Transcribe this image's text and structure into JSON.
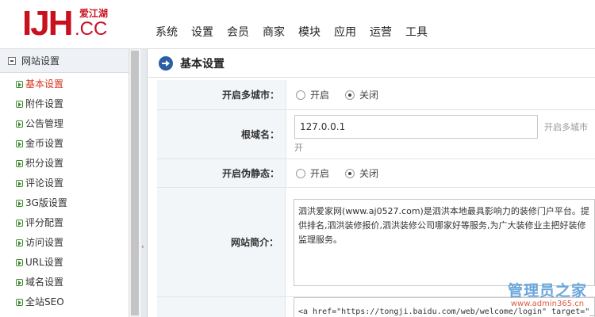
{
  "logo": {
    "main": "IJH",
    "cn": "爱江湖",
    "suffix": ".CC"
  },
  "topnav": [
    "系统",
    "设置",
    "会员",
    "商家",
    "模块",
    "应用",
    "运营",
    "工具"
  ],
  "sidebar": {
    "title": "网站设置",
    "items": [
      "基本设置",
      "附件设置",
      "公告管理",
      "金币设置",
      "积分设置",
      "评论设置",
      "3G版设置",
      "评分配置",
      "访问设置",
      "URL设置",
      "域名设置",
      "全站SEO"
    ],
    "active_index": 0
  },
  "main": {
    "title": "基本设置",
    "multi_city": {
      "label": "开启多城市：",
      "on": "开启",
      "off": "关闭",
      "selected": "关闭"
    },
    "root_domain": {
      "label": "根域名：",
      "value": "127.0.0.1",
      "hint_right": "开启多城市",
      "hint_below": "开"
    },
    "pseudo_static": {
      "label": "开启伪静态：",
      "on": "开启",
      "off": "关闭",
      "selected": "关闭"
    },
    "site_intro": {
      "label": "网站简介：",
      "value": "泗洪爱家网(www.aj0527.com)是泗洪本地最具影响力的装修门户平台。提供排名,泗洪装修报价,泗洪装修公司哪家好等服务,为广大装修业主把好装修监理服务。"
    },
    "stats_code": {
      "value": "<a href=\"https://tongji.baidu.com/web/welcome/login\" target=\"_blank\"> 网站统计</a>"
    }
  },
  "watermark": {
    "title": "管理员之家",
    "url": "www.admin365.cn"
  },
  "colors": {
    "brand_red": "#c8101e",
    "active_item": "#d2361f",
    "title_icon": "#2a5fa3"
  }
}
